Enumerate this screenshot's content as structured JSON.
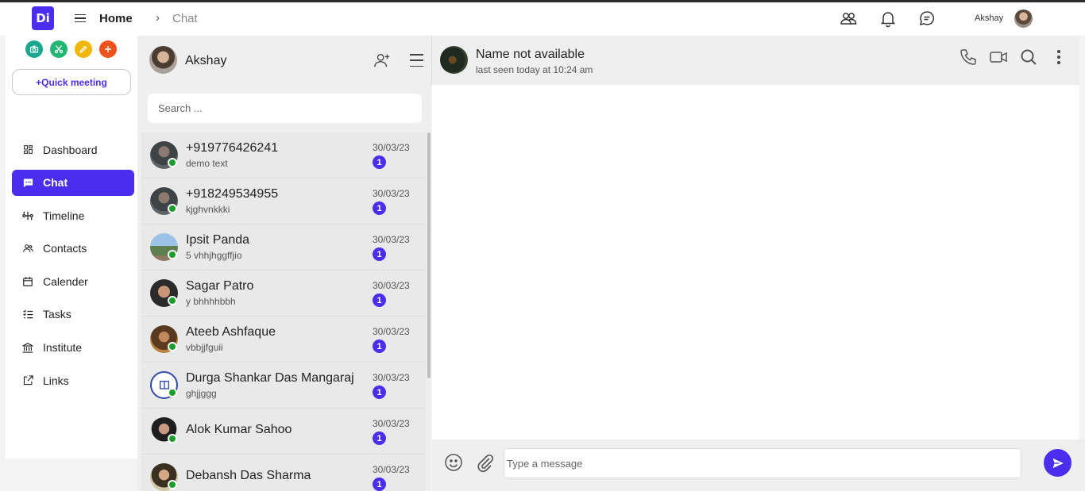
{
  "header": {
    "logo_text": "Di",
    "breadcrumb_home": "Home",
    "breadcrumb_sep": "›",
    "breadcrumb_current": "Chat",
    "user_name": "Akshay",
    "icons": [
      "people-icon",
      "bell-icon",
      "chat-bubble-icon"
    ]
  },
  "sidebar": {
    "quick_icons": [
      {
        "name": "camera-icon",
        "color": "#17a88f"
      },
      {
        "name": "scissors-icon",
        "color": "#22b573"
      },
      {
        "name": "pencil-icon",
        "color": "#f2b705"
      },
      {
        "name": "plus-icon",
        "color": "#f0521c"
      }
    ],
    "quick_meeting_label": "+Quick meeting",
    "items": [
      {
        "label": "Dashboard",
        "icon": "dashboard-icon",
        "active": false
      },
      {
        "label": "Chat",
        "icon": "chat-icon",
        "active": true
      },
      {
        "label": "Timeline",
        "icon": "timeline-icon",
        "active": false
      },
      {
        "label": "Contacts",
        "icon": "contacts-icon",
        "active": false
      },
      {
        "label": "Calender",
        "icon": "calendar-icon",
        "active": false
      },
      {
        "label": "Tasks",
        "icon": "tasks-icon",
        "active": false
      },
      {
        "label": "Institute",
        "icon": "institute-icon",
        "active": false
      },
      {
        "label": "Links",
        "icon": "external-link-icon",
        "active": false
      }
    ]
  },
  "chatlist": {
    "owner_name": "Akshay",
    "search_placeholder": "Search ...",
    "conversations": [
      {
        "name": "+919776426241",
        "preview": "demo text",
        "date": "30/03/23",
        "unread": "1"
      },
      {
        "name": "+918249534955",
        "preview": "kjghvnkkki",
        "date": "30/03/23",
        "unread": "1"
      },
      {
        "name": "Ipsit Panda",
        "preview": "5 vhhjhggffjio",
        "date": "30/03/23",
        "unread": "1"
      },
      {
        "name": "Sagar Patro",
        "preview": "y bhhhhbbh",
        "date": "30/03/23",
        "unread": "1"
      },
      {
        "name": "Ateeb Ashfaque",
        "preview": "vbbjjfguii",
        "date": "30/03/23",
        "unread": "1"
      },
      {
        "name": "Durga Shankar Das Mangaraj",
        "preview": "ghjjggg",
        "date": "30/03/23",
        "unread": "1"
      },
      {
        "name": "Alok Kumar Sahoo",
        "preview": "",
        "date": "30/03/23",
        "unread": "1"
      },
      {
        "name": "Debansh Das Sharma",
        "preview": "",
        "date": "30/03/23",
        "unread": "1"
      }
    ]
  },
  "chat": {
    "contact_name": "Name not available",
    "last_seen": "last seen today at 10:24 am",
    "input_placeholder": "Type a message"
  },
  "colors": {
    "accent": "#4a2ef0",
    "online": "#1a9e2a"
  }
}
